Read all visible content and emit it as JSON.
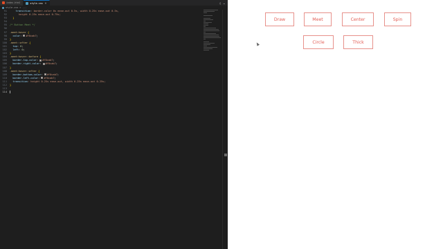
{
  "editor": {
    "tabs": [
      {
        "label": "index.html",
        "icon": "html-file-icon",
        "color": "#e44d26",
        "active": false
      },
      {
        "label": "style.css",
        "icon": "css-file-icon",
        "color": "#519aba",
        "active": true
      }
    ],
    "breadcrumb": "style.css > ...",
    "lines": [
      {
        "n": "91",
        "parts": [
          [
            "    ",
            "lt"
          ],
          [
            "transition",
            "c-prop"
          ],
          [
            ": border-color 0s ease-out 0.5s, width 0.25s ease-out 0.5s,",
            "c-val"
          ]
        ]
      },
      {
        "n": "92",
        "parts": [
          [
            "      height 0.25s ease-out 0.75s;",
            "c-val"
          ]
        ]
      },
      {
        "n": "93",
        "parts": [
          [
            "  }",
            "c-brace"
          ]
        ]
      },
      {
        "n": "94",
        "parts": []
      },
      {
        "n": "95",
        "parts": [
          [
            "/* Button Meet */",
            "c-comment"
          ]
        ]
      },
      {
        "n": "96",
        "parts": []
      },
      {
        "n": "97",
        "parts": [
          [
            ".meet:hover",
            "c-sel"
          ],
          [
            " {",
            "c-brace"
          ]
        ]
      },
      {
        "n": "98",
        "parts": [
          [
            "  color",
            "c-prop"
          ],
          [
            ": ",
            "lt"
          ],
          [
            "SW",
            "swatch"
          ],
          [
            "#f0cab7",
            "c-val"
          ],
          [
            ";",
            "lt"
          ]
        ]
      },
      {
        "n": "99",
        "parts": [
          [
            "}",
            "c-brace"
          ]
        ]
      },
      {
        "n": "100",
        "parts": [
          [
            ".meet::after",
            "c-sel"
          ],
          [
            " {",
            "c-brace"
          ]
        ]
      },
      {
        "n": "101",
        "parts": [
          [
            "  top",
            "c-prop"
          ],
          [
            ": ",
            "lt"
          ],
          [
            "0",
            "c-num"
          ],
          [
            ";",
            "lt"
          ]
        ]
      },
      {
        "n": "102",
        "parts": [
          [
            "  left",
            "c-prop"
          ],
          [
            ": ",
            "lt"
          ],
          [
            "0",
            "c-num"
          ],
          [
            ";",
            "lt"
          ]
        ]
      },
      {
        "n": "103",
        "parts": [
          [
            "}",
            "c-brace"
          ]
        ]
      },
      {
        "n": "104",
        "parts": [
          [
            ".meet:hover::before",
            "c-sel"
          ],
          [
            " {",
            "c-brace"
          ]
        ]
      },
      {
        "n": "105",
        "parts": [
          [
            "  border-top-color",
            "c-prop"
          ],
          [
            ": ",
            "lt"
          ],
          [
            "SW",
            "swatch"
          ],
          [
            "#f0cab7",
            "c-val"
          ],
          [
            ";",
            "lt"
          ]
        ]
      },
      {
        "n": "106",
        "parts": [
          [
            "  border-right-color",
            "c-prop"
          ],
          [
            ": ",
            "lt"
          ],
          [
            "SW",
            "swatch"
          ],
          [
            "#f0cab7",
            "c-val"
          ],
          [
            ";",
            "lt"
          ]
        ]
      },
      {
        "n": "107",
        "parts": [
          [
            "}",
            "c-brace"
          ]
        ]
      },
      {
        "n": "108",
        "parts": [
          [
            ".meet:hover::after",
            "c-sel"
          ],
          [
            " {",
            "c-brace"
          ]
        ]
      },
      {
        "n": "109",
        "parts": [
          [
            "  border-bottom-color",
            "c-prop"
          ],
          [
            ": ",
            "lt"
          ],
          [
            "SW",
            "swatch"
          ],
          [
            "#f0cab7",
            "c-val"
          ],
          [
            ";",
            "lt"
          ]
        ]
      },
      {
        "n": "110",
        "parts": [
          [
            "  border-left-color",
            "c-prop"
          ],
          [
            ": ",
            "lt"
          ],
          [
            "SW",
            "swatch"
          ],
          [
            "#f0cab7",
            "c-val"
          ],
          [
            ";",
            "lt"
          ]
        ]
      },
      {
        "n": "111",
        "parts": [
          [
            "  transition",
            "c-prop"
          ],
          [
            ": height 0.25s ease-out, width 0.25s ease-out 0.25s;",
            "c-val"
          ]
        ]
      },
      {
        "n": "112",
        "parts": [
          [
            "}",
            "c-brace"
          ]
        ]
      },
      {
        "n": "113",
        "parts": []
      },
      {
        "n": "114",
        "parts": [
          [
            "CURSOR",
            "cursor"
          ]
        ],
        "current": true
      }
    ]
  },
  "preview": {
    "buttons": [
      {
        "label": "Draw",
        "name": "draw-button"
      },
      {
        "label": "Meet",
        "name": "meet-button"
      },
      {
        "label": "Center",
        "name": "center-button"
      },
      {
        "label": "Spin",
        "name": "spin-button"
      },
      {
        "label": "Circle",
        "name": "circle-button"
      },
      {
        "label": "Thick",
        "name": "thick-button"
      }
    ],
    "accent": "#e25b52"
  }
}
